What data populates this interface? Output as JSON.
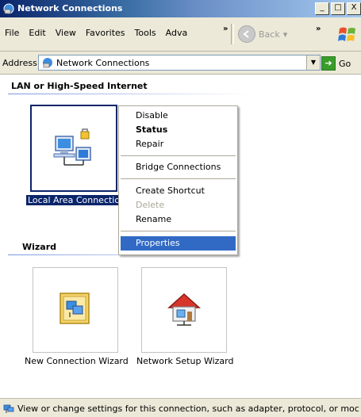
{
  "window": {
    "title": "Network Connections"
  },
  "window_buttons": {
    "minimize": "_",
    "maximize": "□",
    "close": "X"
  },
  "menu": {
    "items": [
      "File",
      "Edit",
      "View",
      "Favorites",
      "Tools",
      "Adva"
    ],
    "more": "»"
  },
  "toolbar": {
    "back_label": "Back",
    "back_arrow": "▾",
    "more": "»"
  },
  "address": {
    "label": "Address",
    "value": "Network Connections",
    "go_label": "Go"
  },
  "groups": {
    "lan": {
      "header": "LAN or High-Speed Internet"
    },
    "wizard": {
      "header": "Wizard"
    }
  },
  "items": {
    "local_area": {
      "label": "Local Area Connectio"
    },
    "new_connection": {
      "label": "New Connection Wizard"
    },
    "network_setup": {
      "label": "Network Setup Wizard"
    }
  },
  "context_menu": {
    "disable": "Disable",
    "status": "Status",
    "repair": "Repair",
    "bridge": "Bridge Connections",
    "shortcut": "Create Shortcut",
    "delete": "Delete",
    "rename": "Rename",
    "properties": "Properties"
  },
  "status_bar": {
    "text": "View or change settings for this connection, such as adapter, protocol, or moc"
  },
  "colors": {
    "title_bar": "#0a246a",
    "selection": "#316ac5",
    "chrome": "#ece9d8"
  }
}
